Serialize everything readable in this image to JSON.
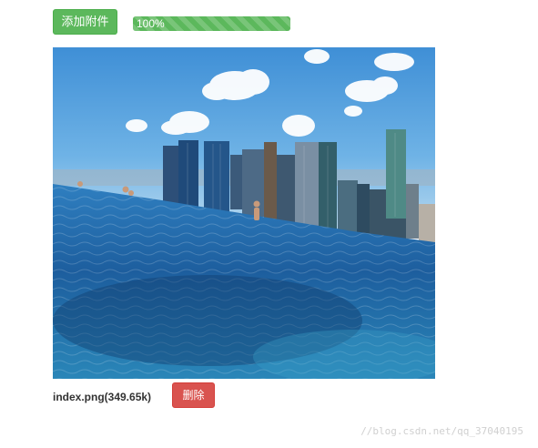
{
  "toolbar": {
    "add_attachment_label": "添加附件",
    "upload_progress": {
      "label": "100%",
      "percent": 100,
      "color": "#5cb85c"
    }
  },
  "preview": {
    "subject": "infinity pool overlooking city skyline"
  },
  "file": {
    "name_and_size": "index.png(349.65k)",
    "delete_label": "删除",
    "delete_color": "#d9534f"
  },
  "watermark": "//blog.csdn.net/qq_37040195"
}
